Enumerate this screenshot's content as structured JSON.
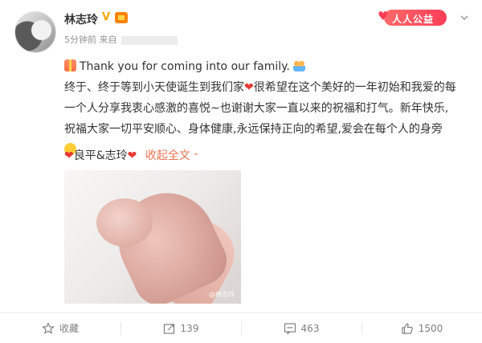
{
  "post": {
    "author": "林志玲",
    "time": "5分钟前",
    "source_prefix": "来自",
    "charity_label": "人人公益",
    "lines": [
      "Thank you for coming into our family.",
      "终于、终于等到小天使诞生到我们家",
      "很希望在这个美好的一年初始和我爱的每",
      "一个人分享我衷心感激的喜悦~也谢谢大家一直以来的祝福和打气。新年快乐,",
      "祝福大家一切平安顺心、身体健康,永远保持正向的希望,爱会在每个人的身旁"
    ],
    "tag_text": "良平&志玲",
    "collapse_label": "收起全文",
    "photo_watermark": "@林志玲"
  },
  "actions": {
    "favorite_label": "收藏",
    "repost_count": "139",
    "comment_count": "463",
    "like_count": "1500"
  },
  "icons": [
    "avatar",
    "verified-v-icon",
    "member-crown-icon",
    "charity-heart-icon",
    "chevron-down-icon",
    "gift-emoji-icon",
    "family-emoji-icon",
    "heart-icon",
    "hug-emoji-icon",
    "star-icon",
    "repost-icon",
    "comment-icon",
    "thumbs-up-icon"
  ],
  "colors": {
    "accent": "#eb7350",
    "heart": "#e53935",
    "muted": "#939393"
  }
}
